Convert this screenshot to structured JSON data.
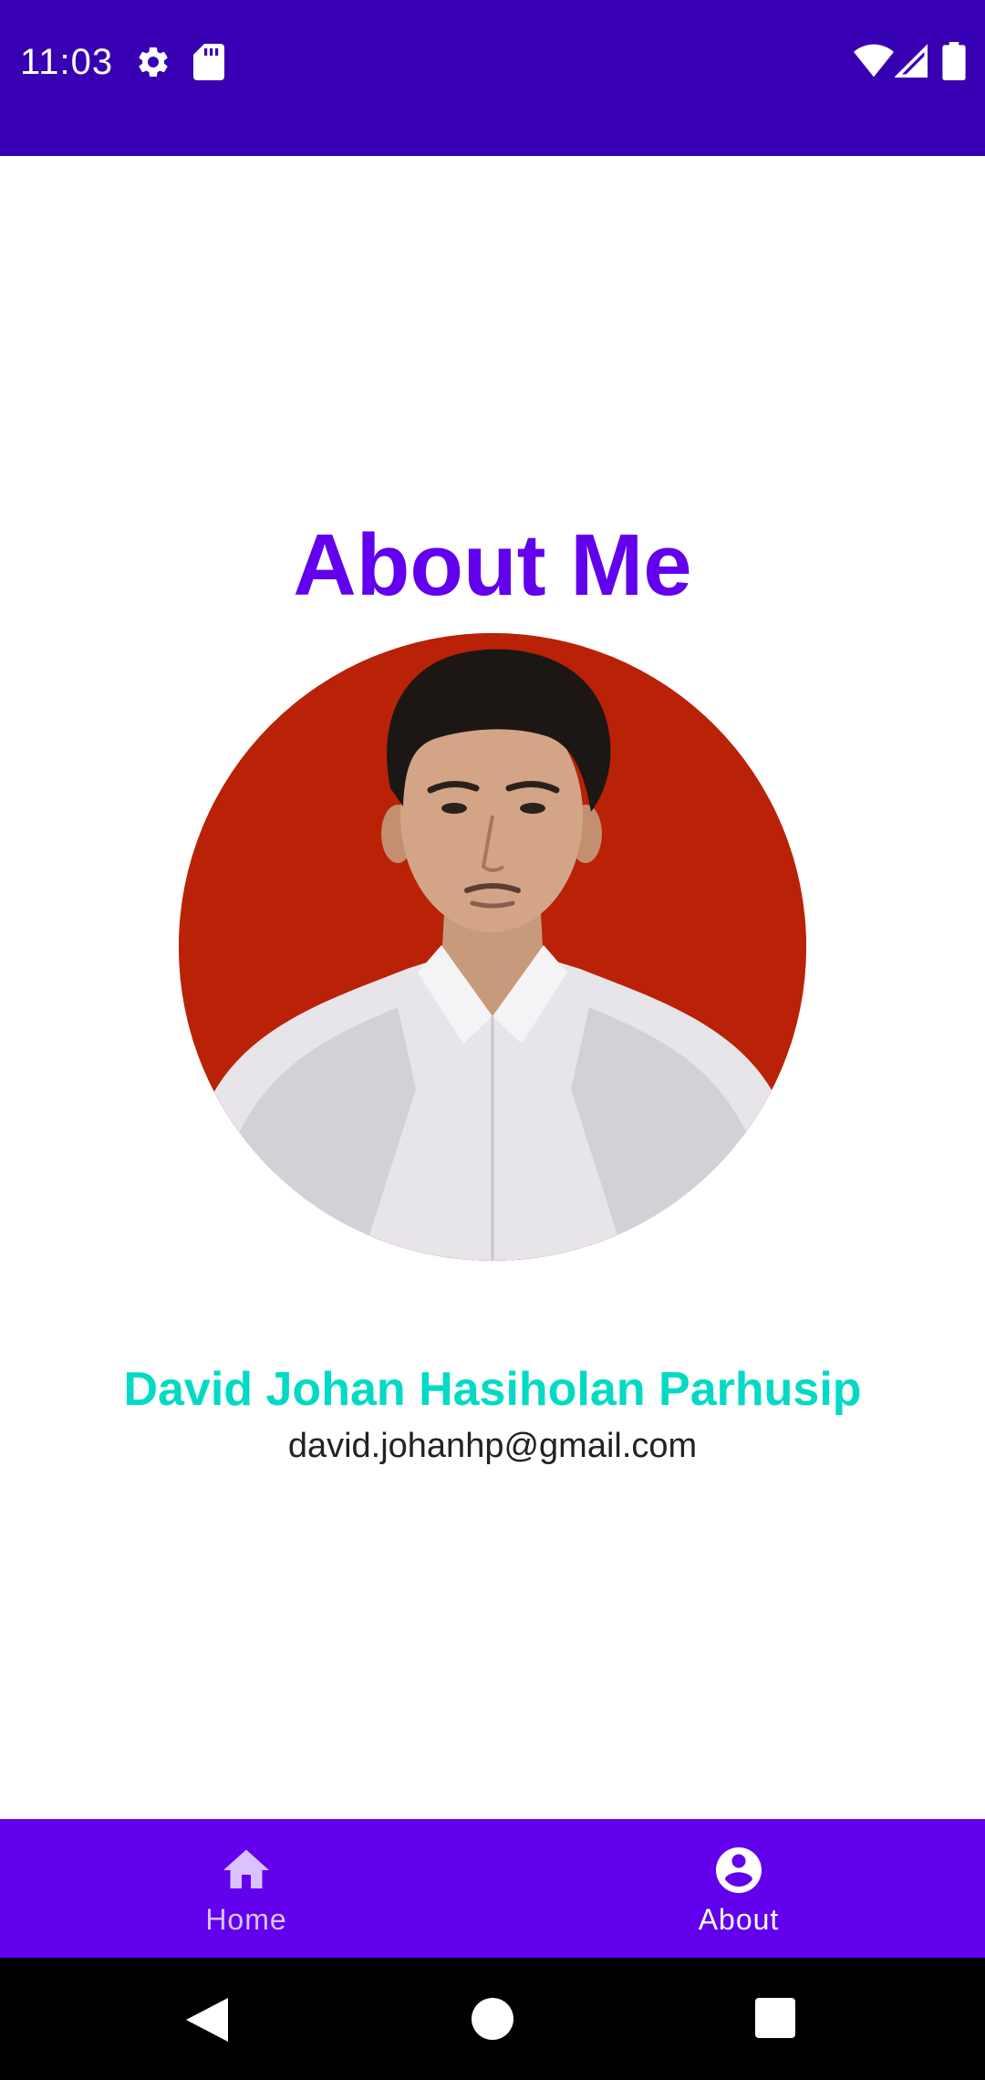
{
  "status_bar": {
    "time": "11:03",
    "icons": [
      "gear-icon",
      "sd-card-icon",
      "wifi-icon",
      "signal-icon",
      "battery-icon"
    ],
    "background": "#3700b3"
  },
  "content": {
    "title": "About Me",
    "title_color": "#6200ee",
    "name": "David Johan Hasiholan Parhusip",
    "name_color": "#03dac5",
    "email": "david.johanhp@gmail.com",
    "photo_background": "#b92206"
  },
  "bottom_nav": {
    "background": "#6200ee",
    "items": [
      {
        "label": "Home",
        "icon": "home-icon",
        "selected": false
      },
      {
        "label": "About",
        "icon": "account-circle-icon",
        "selected": true
      }
    ]
  },
  "system_nav": {
    "icons": [
      "back-icon",
      "home-circle-icon",
      "recents-icon"
    ]
  }
}
